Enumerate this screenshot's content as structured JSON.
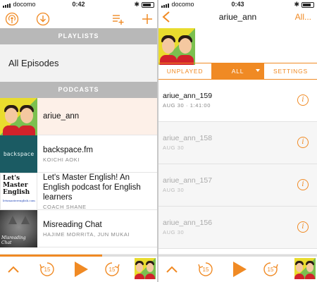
{
  "left_screen": {
    "status": {
      "carrier": "docomo",
      "time": "0:42"
    },
    "sections": {
      "playlists": "PLAYLISTS",
      "podcasts": "PODCASTS"
    },
    "all_episodes": "All Episodes",
    "podcasts": [
      {
        "title": "ariue_ann",
        "author": ""
      },
      {
        "title": "backspace.fm",
        "author": "KOICHI AOKI",
        "art_text": "backspace"
      },
      {
        "title": "Let's Master English! An English podcast for English learners",
        "author": "COACH SHANE",
        "art_lines": [
          "Let's",
          "Master",
          "English"
        ],
        "art_url": "letsmasterenglish.com"
      },
      {
        "title": "Misreading Chat",
        "author": "HAJIME MORRITA, JUN MUKAI",
        "art_text": "Misreading Chat"
      }
    ],
    "player": {
      "skip_back": "15",
      "skip_forward": "15",
      "progress": 0.65
    }
  },
  "right_screen": {
    "status": {
      "carrier": "docomo",
      "time": "0:43"
    },
    "nav": {
      "title": "ariue_ann",
      "all": "All..."
    },
    "filters": [
      "UNPLAYED",
      "ALL",
      "SETTINGS"
    ],
    "episodes": [
      {
        "title": "ariue_ann_159",
        "meta": "AUG 30 · 1:41:00",
        "unplayed": true
      },
      {
        "title": "ariue_ann_158",
        "meta": "AUG 30",
        "unplayed": false
      },
      {
        "title": "ariue_ann_157",
        "meta": "AUG 30",
        "unplayed": false
      },
      {
        "title": "ariue_ann_156",
        "meta": "AUG 30",
        "unplayed": false
      }
    ],
    "player": {
      "skip_back": "15",
      "skip_forward": "15"
    }
  },
  "colors": {
    "accent": "#f08a24",
    "section_header": "#b8b8b8"
  }
}
